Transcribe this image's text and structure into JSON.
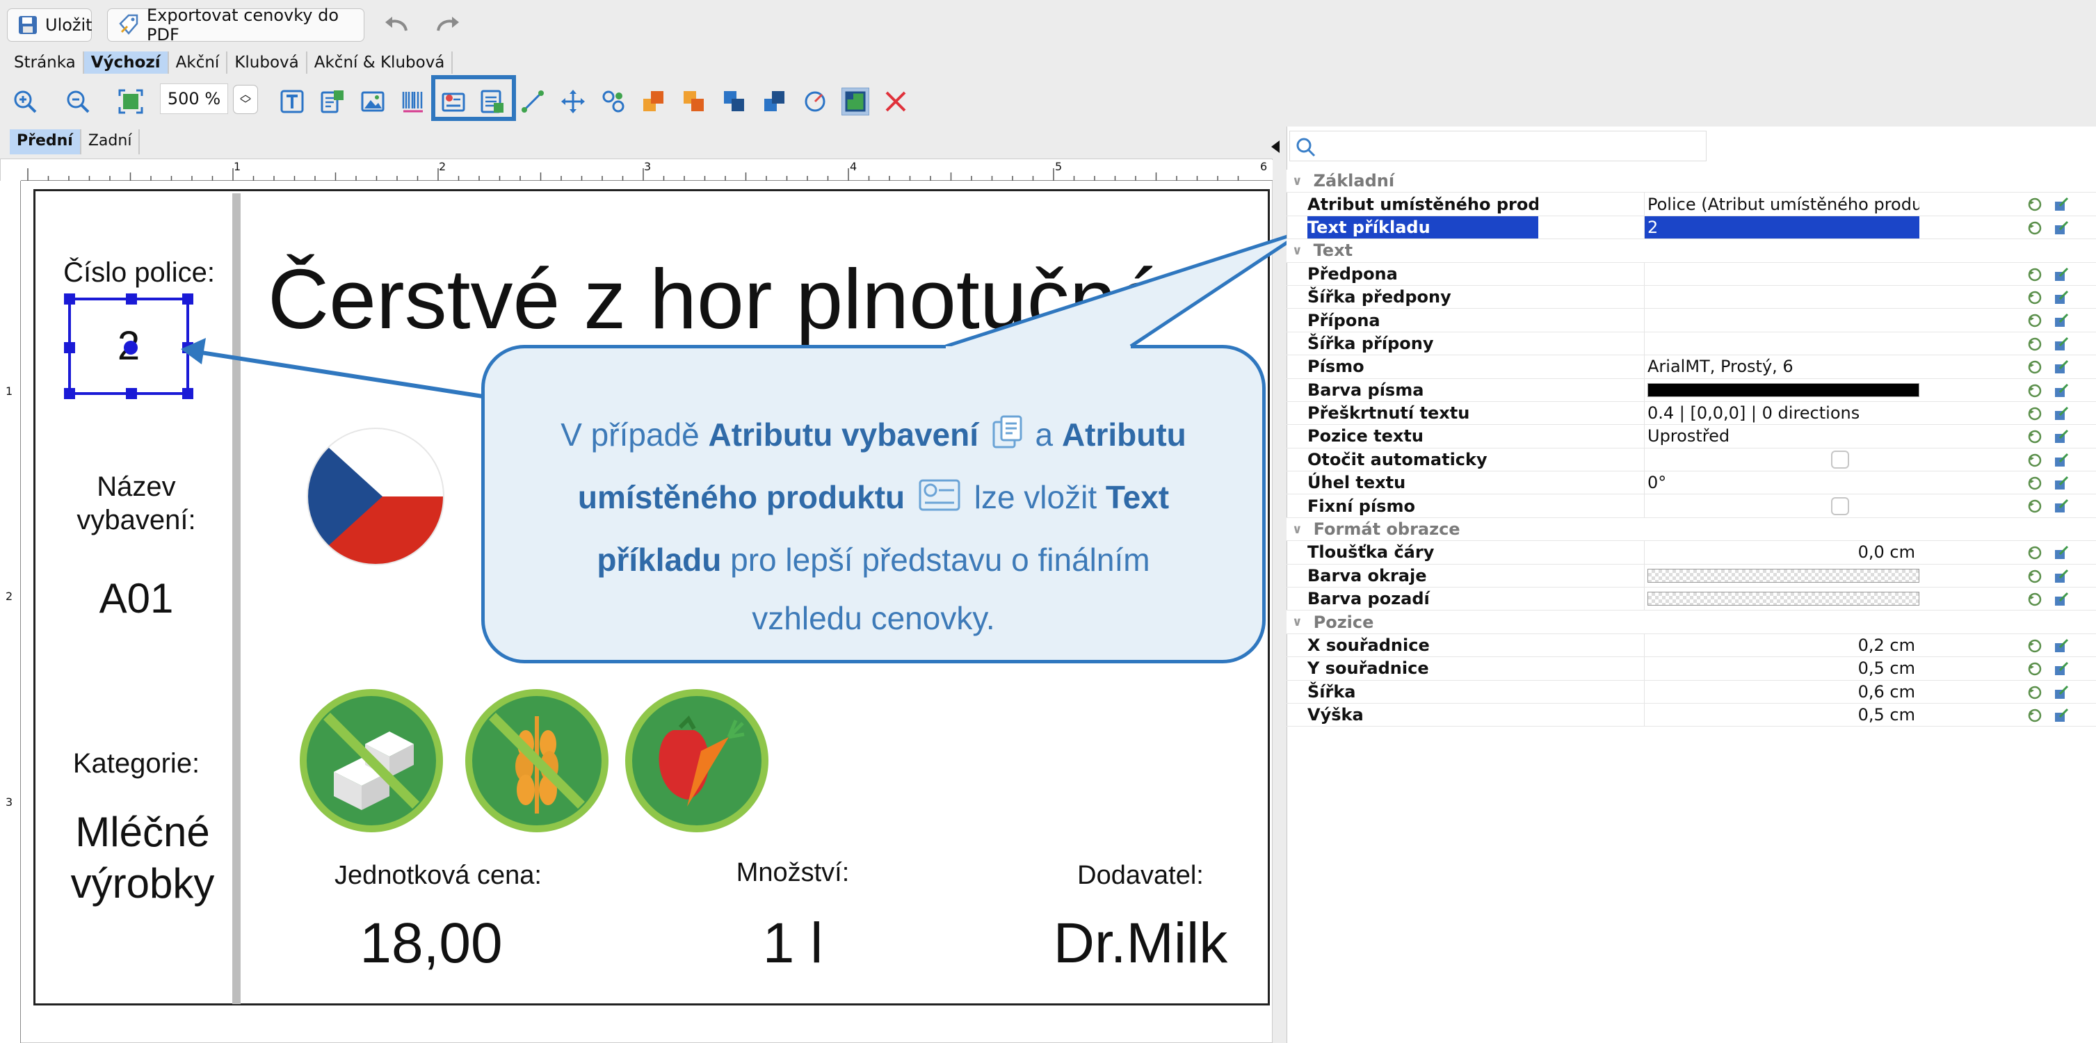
{
  "toolbar": {
    "save_label": "Uložit",
    "export_label": "Exportovat cenovky do PDF",
    "undo_icon": "undo-icon",
    "redo_icon": "redo-icon"
  },
  "template_tabs": [
    {
      "label": "Stránka",
      "selected": false
    },
    {
      "label": "Výchozí",
      "selected": true
    },
    {
      "label": "Akční",
      "selected": false
    },
    {
      "label": "Klubová",
      "selected": false
    },
    {
      "label": "Akční & Klubová",
      "selected": false
    }
  ],
  "zoom": {
    "value": "500 %"
  },
  "side_tabs": [
    {
      "label": "Přední",
      "selected": true
    },
    {
      "label": "Zadní",
      "selected": false
    }
  ],
  "ruler": {
    "top_ticks": [
      "1",
      "2",
      "3",
      "4",
      "5",
      "6"
    ],
    "left_ticks": [
      "1",
      "2",
      "3"
    ]
  },
  "label": {
    "shelf_number_label": "Číslo police:",
    "shelf_number_value": "2",
    "title": "Čerstvé z hor plnotučné",
    "equipment_name_label": "Název vybavení:",
    "equipment_name_value": "A01",
    "category_label": "Kategorie:",
    "category_value": "Mléčné výrobky",
    "unit_price_label": "Jednotková cena:",
    "unit_price_value": "18,00",
    "quantity_label": "Množství:",
    "quantity_value": "1 l",
    "supplier_label": "Dodavatel:",
    "supplier_value": "Dr.Milk"
  },
  "callout": {
    "t1": "V případě ",
    "b1": "Atributu vybavení",
    "t2": " a ",
    "b2": "Atributu umístěného produktu",
    "t3": " lze vložit ",
    "b3": "Text příkladu",
    "t4": " pro lepší představu o finálním vzhledu cenovky."
  },
  "properties": {
    "search_placeholder": "",
    "groups": [
      {
        "name": "Základní",
        "rows": [
          {
            "name": "Atribut umístěného produktu",
            "value": "Police (Atribut umístěného produktu)"
          },
          {
            "name": "Text příkladu",
            "value": "2",
            "selected": true
          }
        ]
      },
      {
        "name": "Text",
        "rows": [
          {
            "name": "Předpona",
            "value": ""
          },
          {
            "name": "Šířka předpony",
            "value": ""
          },
          {
            "name": "Přípona",
            "value": ""
          },
          {
            "name": "Šířka přípony",
            "value": ""
          },
          {
            "name": "Písmo",
            "value": "ArialMT, Prostý, 6"
          },
          {
            "name": "Barva písma",
            "swatch": "black"
          },
          {
            "name": "Přeškrtnutí textu",
            "value": "0.4 | [0,0,0] | 0 directions"
          },
          {
            "name": "Pozice textu",
            "value": "Uprostřed"
          },
          {
            "name": "Otočit automaticky",
            "checkbox": true
          },
          {
            "name": "Úhel textu",
            "value": "0°"
          },
          {
            "name": "Fixní písmo",
            "checkbox": true
          }
        ]
      },
      {
        "name": "Formát obrazce",
        "rows": [
          {
            "name": "Tloušťka čáry",
            "value": "0,0 cm",
            "align": "right"
          },
          {
            "name": "Barva okraje",
            "swatch": "transparent"
          },
          {
            "name": "Barva pozadí",
            "swatch": "transparent"
          }
        ]
      },
      {
        "name": "Pozice",
        "rows": [
          {
            "name": "X souřadnice",
            "value": "0,2 cm",
            "align": "right"
          },
          {
            "name": "Y souřadnice",
            "value": "0,5 cm",
            "align": "right"
          },
          {
            "name": "Šířka",
            "value": "0,6 cm",
            "align": "right"
          },
          {
            "name": "Výška",
            "value": "0,5 cm",
            "align": "right"
          }
        ]
      }
    ]
  },
  "colors": {
    "accent": "#2f77bf",
    "selection": "#1b45c8",
    "flag_blue": "#1f4b8f",
    "flag_red": "#d52b1e",
    "icon_green": "#3f9a4b"
  }
}
